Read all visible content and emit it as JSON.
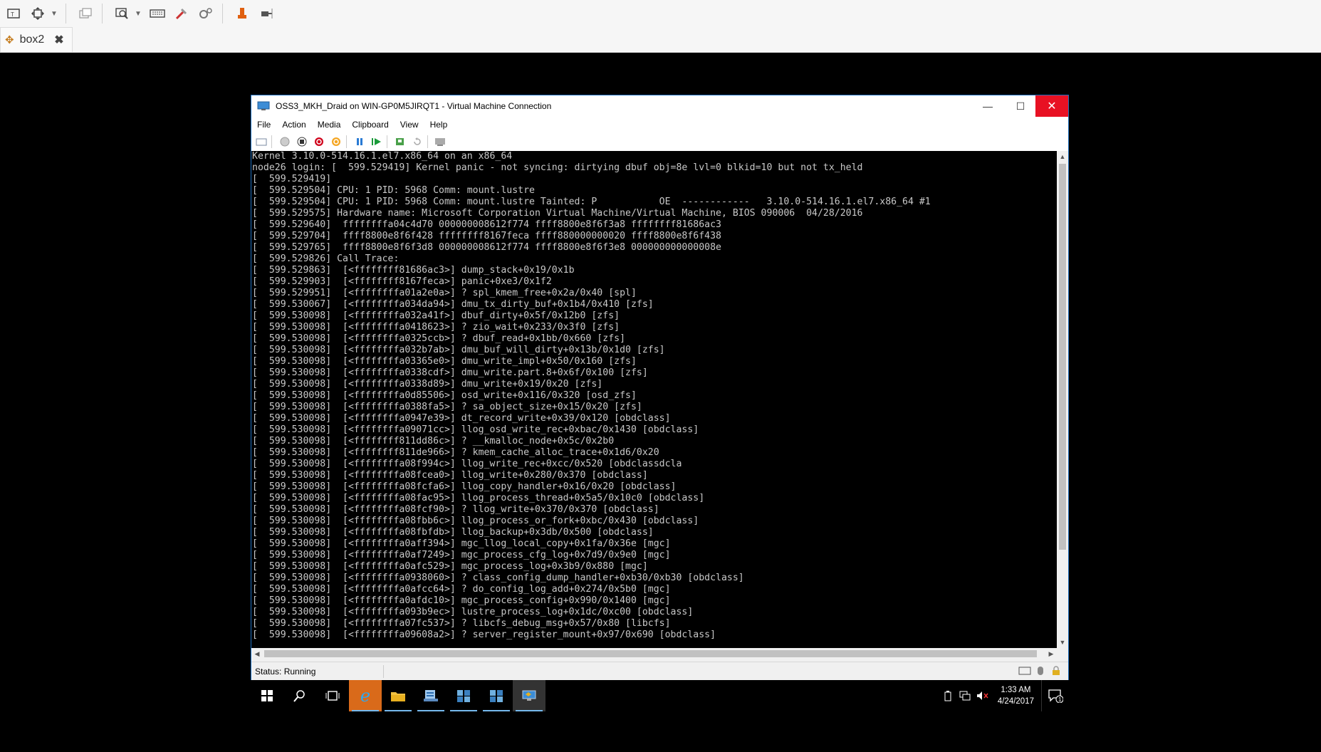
{
  "host": {
    "toolbar_icons": [
      "window-icon",
      "move-icon",
      "chevron-down-icon",
      "windows-icon",
      "zoom-icon",
      "chevron-down-icon",
      "keyboard-icon",
      "tools-icon",
      "settings-icon",
      "usb-icon",
      "plug-icon"
    ],
    "tab": {
      "label": "box2",
      "close": "✖"
    }
  },
  "vm": {
    "title": "OSS3_MKH_Draid on WIN-GP0M5JIRQT1 - Virtual Machine Connection",
    "controls": {
      "minimize": "—",
      "maximize": "☐",
      "close": "✕"
    },
    "menu": [
      "File",
      "Action",
      "Media",
      "Clipboard",
      "View",
      "Help"
    ],
    "status": "Status: Running"
  },
  "console": {
    "lines": [
      "Kernel 3.10.0-514.16.1.el7.x86_64 on an x86_64",
      "",
      "node26 login: [  599.529419] Kernel panic - not syncing: dirtying dbuf obj=8e lvl=0 blkid=10 but not tx_held",
      "[  599.529419]",
      "[  599.529504] CPU: 1 PID: 5968 Comm: mount.lustre ",
      "[  599.529504] CPU: 1 PID: 5968 Comm: mount.lustre Tainted: P           OE  ------------   3.10.0-514.16.1.el7.x86_64 #1",
      "[  599.529575] Hardware name: Microsoft Corporation Virtual Machine/Virtual Machine, BIOS 090006  04/28/2016",
      "[  599.529640]  ffffffffa04c4d70 000000008612f774 ffff8800e8f6f3a8 ffffffff81686ac3",
      "[  599.529704]  ffff8800e8f6f428 ffffffff8167feca ffff880000000020 ffff8800e8f6f438",
      "[  599.529765]  ffff8800e8f6f3d8 000000008612f774 ffff8800e8f6f3e8 000000000000008e",
      "[  599.529826] Call Trace:",
      "[  599.529863]  [<ffffffff81686ac3>] dump_stack+0x19/0x1b",
      "[  599.529903]  [<ffffffff8167feca>] panic+0xe3/0x1f2",
      "[  599.529951]  [<ffffffffa01a2e0a>] ? spl_kmem_free+0x2a/0x40 [spl]",
      "[  599.530067]  [<ffffffffa034da94>] dmu_tx_dirty_buf+0x1b4/0x410 [zfs]",
      "[  599.530098]  [<ffffffffa032a41f>] dbuf_dirty+0x5f/0x12b0 [zfs]",
      "[  599.530098]  [<ffffffffa0418623>] ? zio_wait+0x233/0x3f0 [zfs]",
      "[  599.530098]  [<ffffffffa0325ccb>] ? dbuf_read+0x1bb/0x660 [zfs]",
      "[  599.530098]  [<ffffffffa032b7ab>] dmu_buf_will_dirty+0x13b/0x1d0 [zfs]",
      "[  599.530098]  [<ffffffffa03365e0>] dmu_write_impl+0x50/0x160 [zfs]",
      "[  599.530098]  [<ffffffffa0338cdf>] dmu_write.part.8+0x6f/0x100 [zfs]",
      "[  599.530098]  [<ffffffffa0338d89>] dmu_write+0x19/0x20 [zfs]",
      "[  599.530098]  [<ffffffffa0d85506>] osd_write+0x116/0x320 [osd_zfs]",
      "[  599.530098]  [<ffffffffa0388fa5>] ? sa_object_size+0x15/0x20 [zfs]",
      "[  599.530098]  [<ffffffffa0947e39>] dt_record_write+0x39/0x120 [obdclass]",
      "[  599.530098]  [<ffffffffa09071cc>] llog_osd_write_rec+0xbac/0x1430 [obdclass]",
      "[  599.530098]  [<ffffffff811dd86c>] ? __kmalloc_node+0x5c/0x2b0",
      "[  599.530098]  [<ffffffff811de966>] ? kmem_cache_alloc_trace+0x1d6/0x20",
      "[  599.530098]  [<ffffffffa08f994c>] llog_write_rec+0xcc/0x520 [obdclassdcla",
      "[  599.530098]  [<ffffffffa08fcea0>] llog_write+0x280/0x370 [obdclass]",
      "[  599.530098]  [<ffffffffa08fcfa6>] llog_copy_handler+0x16/0x20 [obdclass]",
      "[  599.530098]  [<ffffffffa08fac95>] llog_process_thread+0x5a5/0x10c0 [obdclass]",
      "[  599.530098]  [<ffffffffa08fcf90>] ? llog_write+0x370/0x370 [obdclass]",
      "[  599.530098]  [<ffffffffa08fbb6c>] llog_process_or_fork+0xbc/0x430 [obdclass]",
      "[  599.530098]  [<ffffffffa08fbfdb>] llog_backup+0x3db/0x500 [obdclass]",
      "[  599.530098]  [<ffffffffa0aff394>] mgc_llog_local_copy+0x1fa/0x36e [mgc]",
      "[  599.530098]  [<ffffffffa0af7249>] mgc_process_cfg_log+0x7d9/0x9e0 [mgc]",
      "[  599.530098]  [<ffffffffa0afc529>] mgc_process_log+0x3b9/0x880 [mgc]",
      "[  599.530098]  [<ffffffffa0938060>] ? class_config_dump_handler+0xb30/0xb30 [obdclass]",
      "[  599.530098]  [<ffffffffa0afcc64>] ? do_config_log_add+0x274/0x5b0 [mgc]",
      "[  599.530098]  [<ffffffffa0afdc10>] mgc_process_config+0x990/0x1400 [mgc]",
      "[  599.530098]  [<ffffffffa093b9ec>] lustre_process_log+0x1dc/0xc00 [obdclass]",
      "[  599.530098]  [<ffffffffa07fc537>] ? libcfs_debug_msg+0x57/0x80 [libcfs]",
      "[  599.530098]  [<ffffffffa09608a2>] ? server_register_mount+0x97/0x690 [obdclass]"
    ]
  },
  "taskbar": {
    "time": "1:33 AM",
    "date": "4/24/2017",
    "notification_count": "1"
  },
  "colors": {
    "accent": "#1e6fbf",
    "close_red": "#e81123",
    "ie_orange": "#d96a1a"
  }
}
